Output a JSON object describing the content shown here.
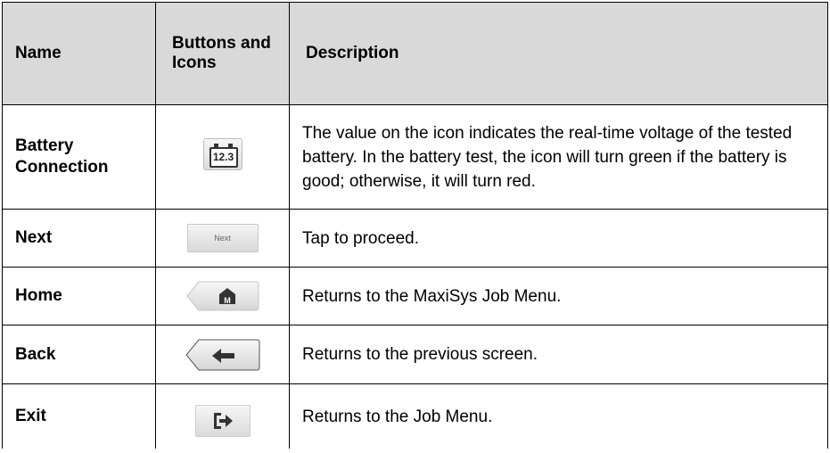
{
  "table": {
    "headers": {
      "name": "Name",
      "buttons": "Buttons and Icons",
      "description": "Description"
    },
    "rows": [
      {
        "name": "Battery Connection",
        "icon": "battery-voltage-icon",
        "icon_text": "12.3",
        "description": "The value on the icon indicates the real-time voltage of the tested battery. In the battery test, the icon will turn green if the battery is good; otherwise, it will turn red."
      },
      {
        "name": "Next",
        "icon": "next-button",
        "icon_text": "Next",
        "description": "Tap to proceed."
      },
      {
        "name": "Home",
        "icon": "home-icon",
        "icon_text": "M",
        "description": "Returns to the MaxiSys Job Menu."
      },
      {
        "name": "Back",
        "icon": "back-arrow-icon",
        "description": "Returns to the previous screen."
      },
      {
        "name": "Exit",
        "icon": "exit-icon",
        "description": "Returns to the Job Menu."
      }
    ]
  }
}
